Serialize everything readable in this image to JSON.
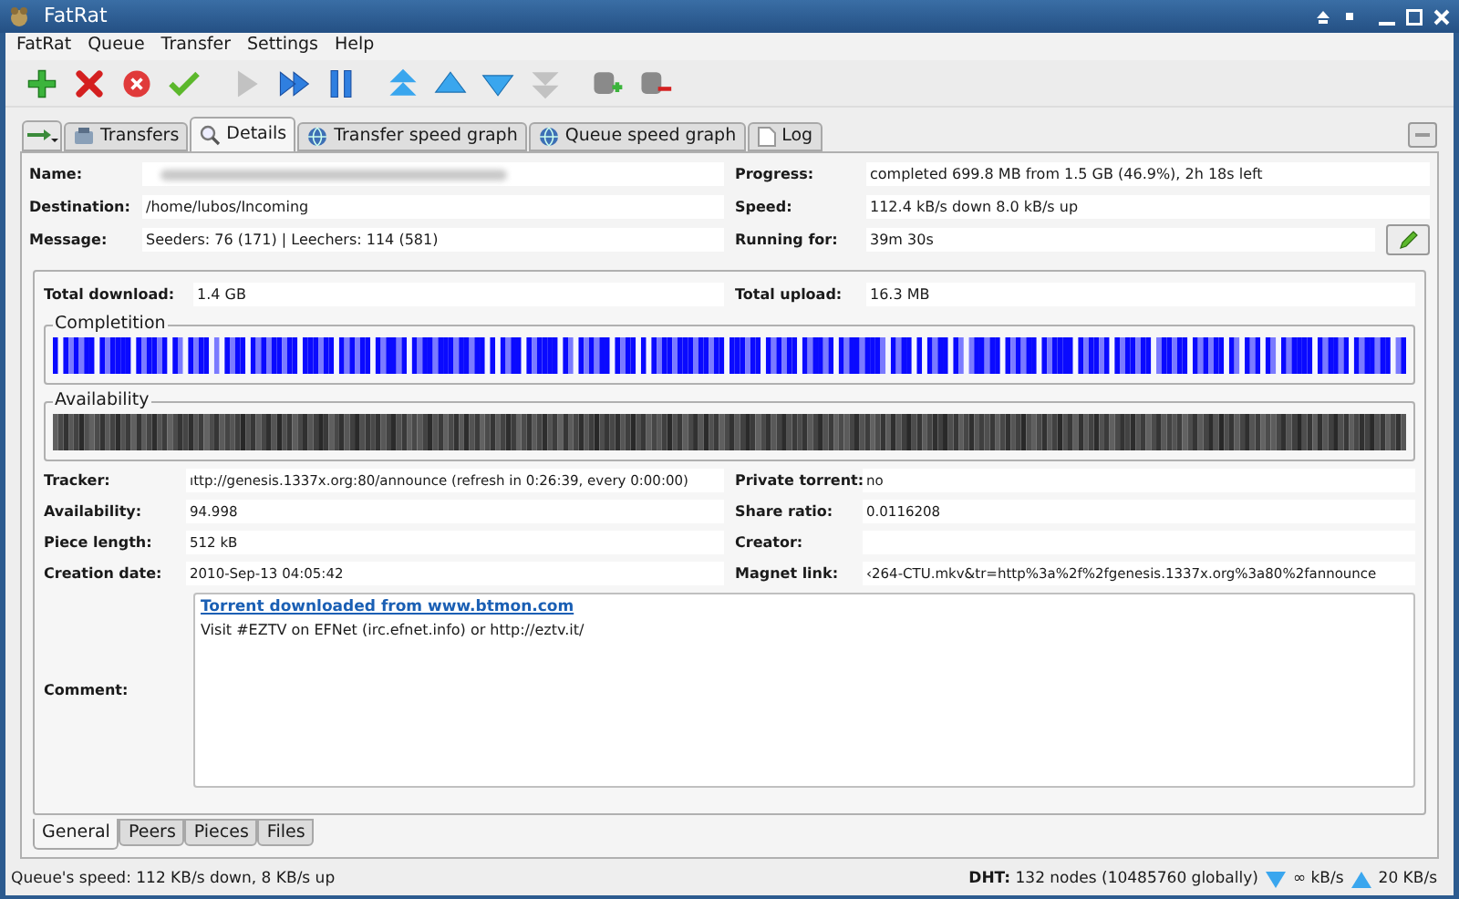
{
  "window": {
    "title": "FatRat"
  },
  "menu": [
    "FatRat",
    "Queue",
    "Transfer",
    "Settings",
    "Help"
  ],
  "toolbar": [
    {
      "kind": "add",
      "disabled": false
    },
    {
      "kind": "delete",
      "disabled": false
    },
    {
      "kind": "delete-data",
      "disabled": false
    },
    {
      "kind": "resume",
      "disabled": false
    },
    {
      "kind": "start",
      "disabled": true
    },
    {
      "kind": "force",
      "disabled": false
    },
    {
      "kind": "pause",
      "disabled": false
    },
    {
      "kind": "top",
      "disabled": false
    },
    {
      "kind": "up",
      "disabled": false
    },
    {
      "kind": "down",
      "disabled": false
    },
    {
      "kind": "bottom",
      "disabled": true
    },
    {
      "kind": "queue-add",
      "disabled": false
    },
    {
      "kind": "queue-remove",
      "disabled": false
    }
  ],
  "tabs": [
    {
      "label": "Transfers",
      "selected": false
    },
    {
      "label": "Details",
      "selected": true
    },
    {
      "label": "Transfer speed graph",
      "selected": false
    },
    {
      "label": "Queue speed graph",
      "selected": false
    },
    {
      "label": "Log",
      "selected": false
    }
  ],
  "info_left": [
    {
      "label": "Name:",
      "kind": "hidden"
    },
    {
      "label": "Destination:",
      "value": "/home/lubos/Incoming",
      "kind": "text"
    },
    {
      "label": "Message:",
      "value": "Seeders: 76 (171) | Leechers: 114 (581)",
      "kind": "text"
    }
  ],
  "info_right": [
    {
      "label": "Progress:",
      "value": "completed 699.8 MB from 1.5 GB (46.9%), 2h 18s left",
      "kind": "text"
    },
    {
      "label": "Speed:",
      "value": "112.4 kB/s down 8.0 kB/s up",
      "kind": "text"
    },
    {
      "label": "Running for:",
      "value": "39m 30s",
      "kind": "edit"
    }
  ],
  "totals": [
    {
      "label": "Total download:",
      "value": "1.4 GB"
    },
    {
      "label": "Total upload:",
      "value": "16.3 MB"
    }
  ],
  "completion": {
    "title": "Completition"
  },
  "availability_bar": {
    "title": "Availability"
  },
  "details_left": [
    {
      "label": "Tracker:",
      "value": "ıttp://genesis.1337x.org:80/announce (refresh in 0:26:39, every 0:00:00)"
    },
    {
      "label": "Availability:",
      "value": "94.998"
    },
    {
      "label": "Piece length:",
      "value": "512 kB"
    },
    {
      "label": "Creation date:",
      "value": "2010-Sep-13 04:05:42"
    }
  ],
  "details_right": [
    {
      "label": "Private torrent:",
      "value": "no"
    },
    {
      "label": "Share ratio:",
      "value": "0.0116208"
    },
    {
      "label": "Creator:"
    },
    {
      "label": "Magnet link:",
      "value": "‹264-CTU.mkv&tr=http%3a%2f%2fgenesis.1337x.org%3a80%2fannounce"
    }
  ],
  "comment": {
    "label": "Comment:",
    "link": "Torrent downloaded from www.btmon.com",
    "text": "Visit #EZTV on EFNet (irc.efnet.info) or http://eztv.it/"
  },
  "bottom_tabs": [
    {
      "label": "General",
      "selected": true
    },
    {
      "label": "Peers",
      "selected": false
    },
    {
      "label": "Pieces",
      "selected": false
    },
    {
      "label": "Files",
      "selected": false
    }
  ],
  "status_bar": {
    "queue_speed": "Queue's speed: 112 KB/s down, 8 KB/s up",
    "dht": "**DHT:** 132 nodes (10485760 globally)",
    "down": "∞ kB/s",
    "up": "20 KB/s"
  }
}
